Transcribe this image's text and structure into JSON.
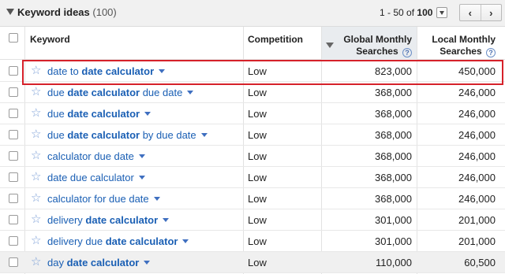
{
  "header": {
    "title": "Keyword ideas",
    "count": "(100)",
    "range": "1 - 50",
    "of_label": "of",
    "total": "100",
    "prev_label": "‹",
    "next_label": "›"
  },
  "columns": {
    "keyword": "Keyword",
    "competition": "Competition",
    "global_line1": "Global Monthly",
    "global_line2": "Searches",
    "local_line1": "Local Monthly",
    "local_line2": "Searches",
    "help_glyph": "?"
  },
  "rows": [
    {
      "pre": "date to ",
      "bold": "date calculator",
      "post": "",
      "competition": "Low",
      "global": "823,000",
      "local": "450,000"
    },
    {
      "pre": "due ",
      "bold": "date calculator",
      "post": " due date",
      "competition": "Low",
      "global": "368,000",
      "local": "246,000"
    },
    {
      "pre": "due ",
      "bold": "date calculator",
      "post": "",
      "competition": "Low",
      "global": "368,000",
      "local": "246,000"
    },
    {
      "pre": "due ",
      "bold": "date calculator",
      "post": " by due date",
      "competition": "Low",
      "global": "368,000",
      "local": "246,000"
    },
    {
      "pre": "calculator due date",
      "bold": "",
      "post": "",
      "competition": "Low",
      "global": "368,000",
      "local": "246,000"
    },
    {
      "pre": "date due calculator",
      "bold": "",
      "post": "",
      "competition": "Low",
      "global": "368,000",
      "local": "246,000"
    },
    {
      "pre": "calculator for due date",
      "bold": "",
      "post": "",
      "competition": "Low",
      "global": "368,000",
      "local": "246,000"
    },
    {
      "pre": "delivery ",
      "bold": "date calculator",
      "post": "",
      "competition": "Low",
      "global": "301,000",
      "local": "201,000"
    },
    {
      "pre": "delivery due ",
      "bold": "date calculator",
      "post": "",
      "competition": "Low",
      "global": "301,000",
      "local": "201,000"
    },
    {
      "pre": "day ",
      "bold": "date calculator",
      "post": "",
      "competition": "Low",
      "global": "110,000",
      "local": "60,500"
    }
  ],
  "colors": {
    "link": "#1a5fb4",
    "highlight_border": "#d6212a",
    "star": "#7da0d7"
  },
  "icons": {
    "collapse": "triangle-down-icon",
    "star": "star-outline-icon",
    "help": "help-icon",
    "sort": "sort-desc-icon"
  }
}
